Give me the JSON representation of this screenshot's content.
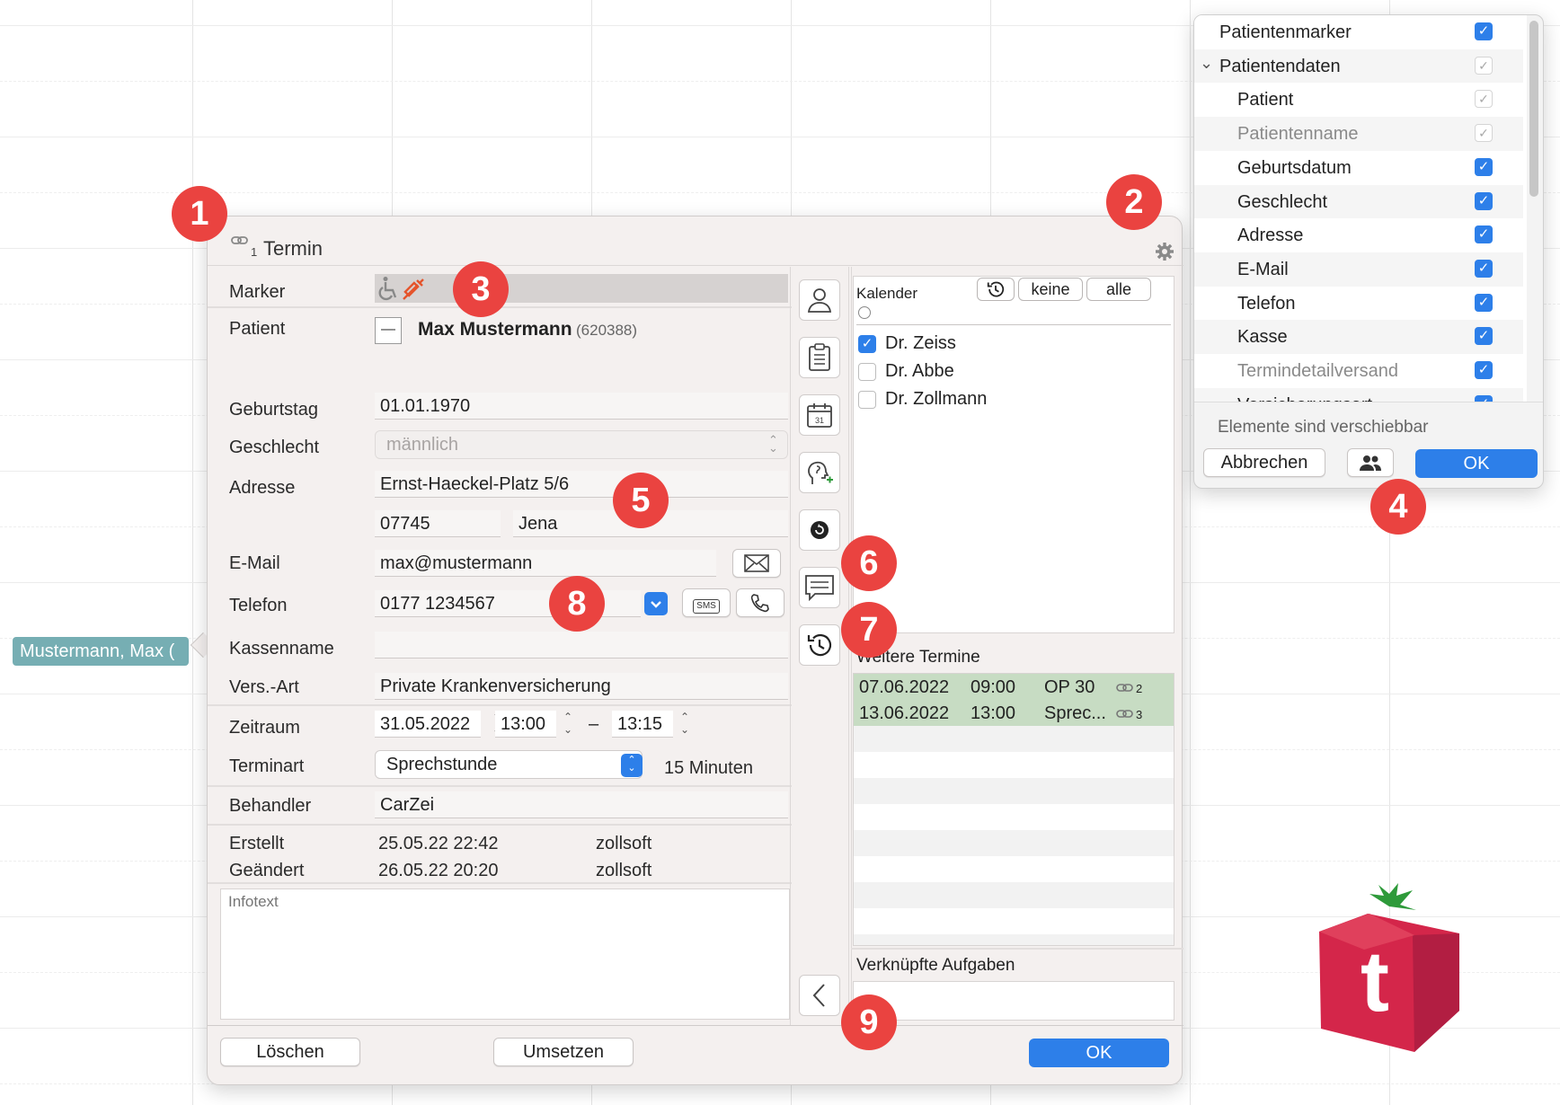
{
  "calendar": {
    "event_chip": "Mustermann, Max ("
  },
  "popover": {
    "link_count": "1",
    "title": "Termin",
    "labels": {
      "marker": "Marker",
      "patient": "Patient",
      "birthday": "Geburtstag",
      "gender": "Geschlecht",
      "address": "Adresse",
      "email": "E-Mail",
      "phone": "Telefon",
      "insurer_name": "Kassenname",
      "insurance_type": "Vers.-Art",
      "period": "Zeitraum",
      "appointment_type": "Terminart",
      "practitioner": "Behandler",
      "created": "Erstellt",
      "modified": "Geändert"
    },
    "patient_name": "Max Mustermann",
    "patient_id": "(620388)",
    "patient_toggle": "—",
    "birthday": "01.01.1970",
    "gender": "männlich",
    "street": "Ernst-Haeckel-Platz 5/6",
    "zip": "07745",
    "city": "Jena",
    "email": "max@mustermann",
    "phone": "0177 1234567",
    "sms_label": "SMS",
    "insurer_name": "",
    "insurance_type": "Private Krankenversicherung",
    "date": "31.05.2022",
    "time_from": "13:00",
    "dash": "–",
    "time_to": "13:15",
    "appointment_type": "Sprechstunde",
    "duration": "15 Minuten",
    "practitioner": "CarZei",
    "created_at": "25.05.22 22:42",
    "created_by": "zollsoft",
    "modified_at": "26.05.22 20:20",
    "modified_by": "zollsoft",
    "info_placeholder": "Infotext",
    "buttons": {
      "delete": "Löschen",
      "move": "Umsetzen",
      "ok": "OK"
    }
  },
  "calendar_panel": {
    "label": "Kalender",
    "btn_none": "keine",
    "btn_all": "alle",
    "doctors": [
      {
        "name": "Dr. Zeiss",
        "checked": true
      },
      {
        "name": "Dr. Abbe",
        "checked": false
      },
      {
        "name": "Dr. Zollmann",
        "checked": false
      }
    ],
    "further_title": "Weitere Termine",
    "further": [
      {
        "date": "07.06.2022",
        "time": "09:00",
        "type": "OP 30",
        "links": "2"
      },
      {
        "date": "13.06.2022",
        "time": "13:00",
        "type": "Sprec...",
        "links": "3"
      }
    ],
    "tasks_title": "Verknüpfte Aufgaben"
  },
  "settings_menu": {
    "items": [
      {
        "label": "Patientenmarker",
        "state": "checked",
        "indent": 0
      },
      {
        "label": "Patientendaten",
        "state": "gray",
        "indent": 0,
        "expand": "⌄"
      },
      {
        "label": "Patient",
        "state": "gray",
        "indent": 1
      },
      {
        "label": "Patientenname",
        "state": "gray",
        "indent": 1,
        "dim": true
      },
      {
        "label": "Geburtsdatum",
        "state": "checked",
        "indent": 1
      },
      {
        "label": "Geschlecht",
        "state": "checked",
        "indent": 1
      },
      {
        "label": "Adresse",
        "state": "checked",
        "indent": 1
      },
      {
        "label": "E-Mail",
        "state": "checked",
        "indent": 1
      },
      {
        "label": "Telefon",
        "state": "checked",
        "indent": 1
      },
      {
        "label": "Kasse",
        "state": "checked",
        "indent": 1
      },
      {
        "label": "Termindetailversand",
        "state": "checked",
        "indent": 1,
        "dim": true
      },
      {
        "label": "Versicherungsart",
        "state": "checked",
        "indent": 1
      }
    ],
    "hint": "Elemente sind verschiebbar",
    "cancel": "Abbrechen",
    "ok": "OK"
  },
  "badges": [
    "1",
    "2",
    "3",
    "4",
    "5",
    "6",
    "7",
    "8",
    "9"
  ],
  "logo_letter": "t",
  "colors": {
    "accent": "#2d7fe9",
    "badge": "#ea4340",
    "logo": "#d4264a",
    "chip": "#76aeb3",
    "appointment_row": "#c7dcc3"
  }
}
